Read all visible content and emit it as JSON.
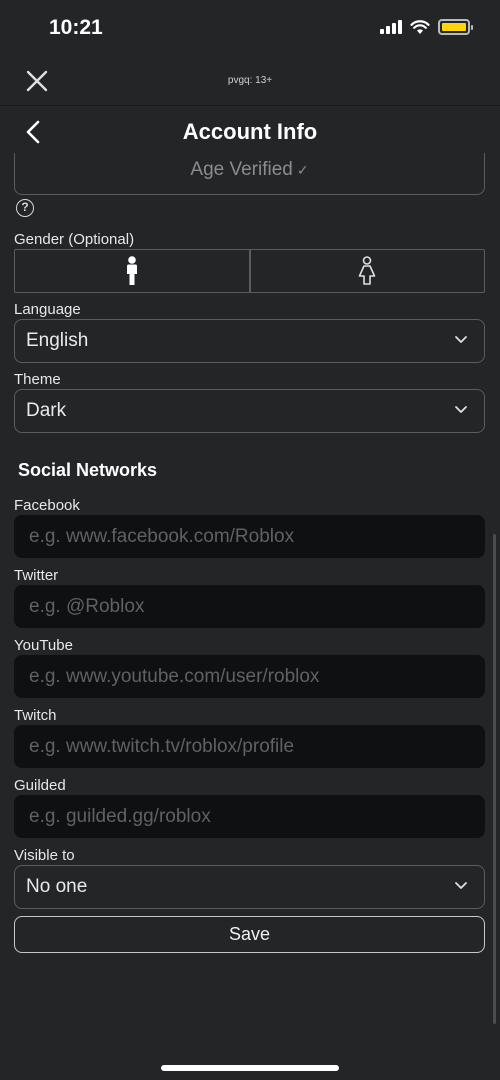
{
  "status_bar": {
    "time": "10:21"
  },
  "top_bar": {
    "label": "pvgq: 13+"
  },
  "header": {
    "title": "Account Info"
  },
  "age": {
    "label": "Age Verified",
    "check": "✓"
  },
  "help": {
    "glyph": "?"
  },
  "gender": {
    "label": "Gender (Optional)",
    "options": [
      "male-icon",
      "female-icon"
    ]
  },
  "language": {
    "label": "Language",
    "value": "English"
  },
  "theme": {
    "label": "Theme",
    "value": "Dark"
  },
  "social": {
    "title": "Social Networks",
    "facebook": {
      "label": "Facebook",
      "placeholder": "e.g. www.facebook.com/Roblox"
    },
    "twitter": {
      "label": "Twitter",
      "placeholder": "e.g. @Roblox"
    },
    "youtube": {
      "label": "YouTube",
      "placeholder": "e.g. www.youtube.com/user/roblox"
    },
    "twitch": {
      "label": "Twitch",
      "placeholder": "e.g. www.twitch.tv/roblox/profile"
    },
    "guilded": {
      "label": "Guilded",
      "placeholder": "e.g. guilded.gg/roblox"
    }
  },
  "visibility": {
    "label": "Visible to",
    "value": "No one"
  },
  "save": {
    "label": "Save"
  },
  "colors": {
    "background": "#232527",
    "input_bg": "#0f1011",
    "border": "#5a5c60",
    "battery": "#ffd60a"
  }
}
